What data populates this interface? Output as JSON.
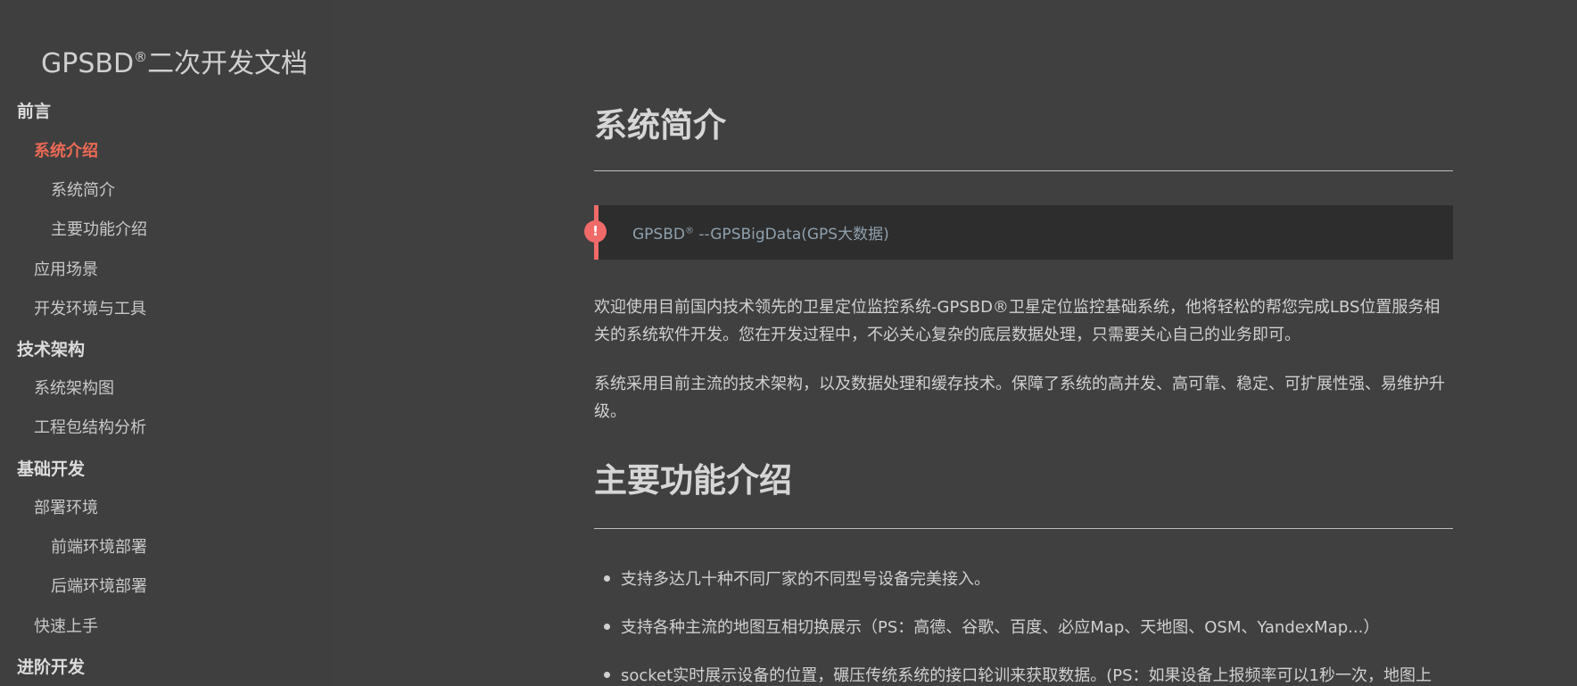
{
  "sidebar": {
    "brand": "GPSBD",
    "brand_reg": "®",
    "brand_suffix": "二次开发文档",
    "items": [
      {
        "label": "前言"
      },
      {
        "label": "系统介绍"
      },
      {
        "label": "系统简介"
      },
      {
        "label": "主要功能介绍"
      },
      {
        "label": "应用场景"
      },
      {
        "label": "开发环境与工具"
      },
      {
        "label": "技术架构"
      },
      {
        "label": "系统架构图"
      },
      {
        "label": "工程包结构分析"
      },
      {
        "label": "基础开发"
      },
      {
        "label": "部署环境"
      },
      {
        "label": "前端环境部署"
      },
      {
        "label": "后端环境部署"
      },
      {
        "label": "快速上手"
      },
      {
        "label": "进阶开发"
      }
    ]
  },
  "main": {
    "section1_title": "系统简介",
    "callout": {
      "icon": "!",
      "text_a": "GPSBD",
      "text_reg": "®",
      "text_b": " --GPSBigData(GPS大数据)"
    },
    "para1": "欢迎使用目前国内技术领先的卫星定位监控系统-GPSBD®卫星定位监控基础系统，他将轻松的帮您完成LBS位置服务相关的系统软件开发。您在开发过程中，不必关心复杂的底层数据处理，只需要关心自己的业务即可。",
    "para2": "系统采用目前主流的技术架构，以及数据处理和缓存技术。保障了系统的高并发、高可靠、稳定、可扩展性强、易维护升级。",
    "section2_title": "主要功能介绍",
    "bullets": [
      "支持多达几十种不同厂家的不同型号设备完美接入。",
      "支持各种主流的地图互相切换展示（PS：高德、谷歌、百度、必应Map、天地图、OSM、YandexMap...）",
      "socket实时展示设备的位置，碾压传统系统的接口轮训来获取数据。(PS：如果设备上报频率可以1秒一次，地图上"
    ]
  },
  "colors": {
    "background": "#404040",
    "active_link": "#ec6a55",
    "callout_accent": "#f06a6a",
    "callout_bg": "#2d2d2d"
  },
  "icons": {
    "callout_icon": "alert-circle-icon"
  }
}
